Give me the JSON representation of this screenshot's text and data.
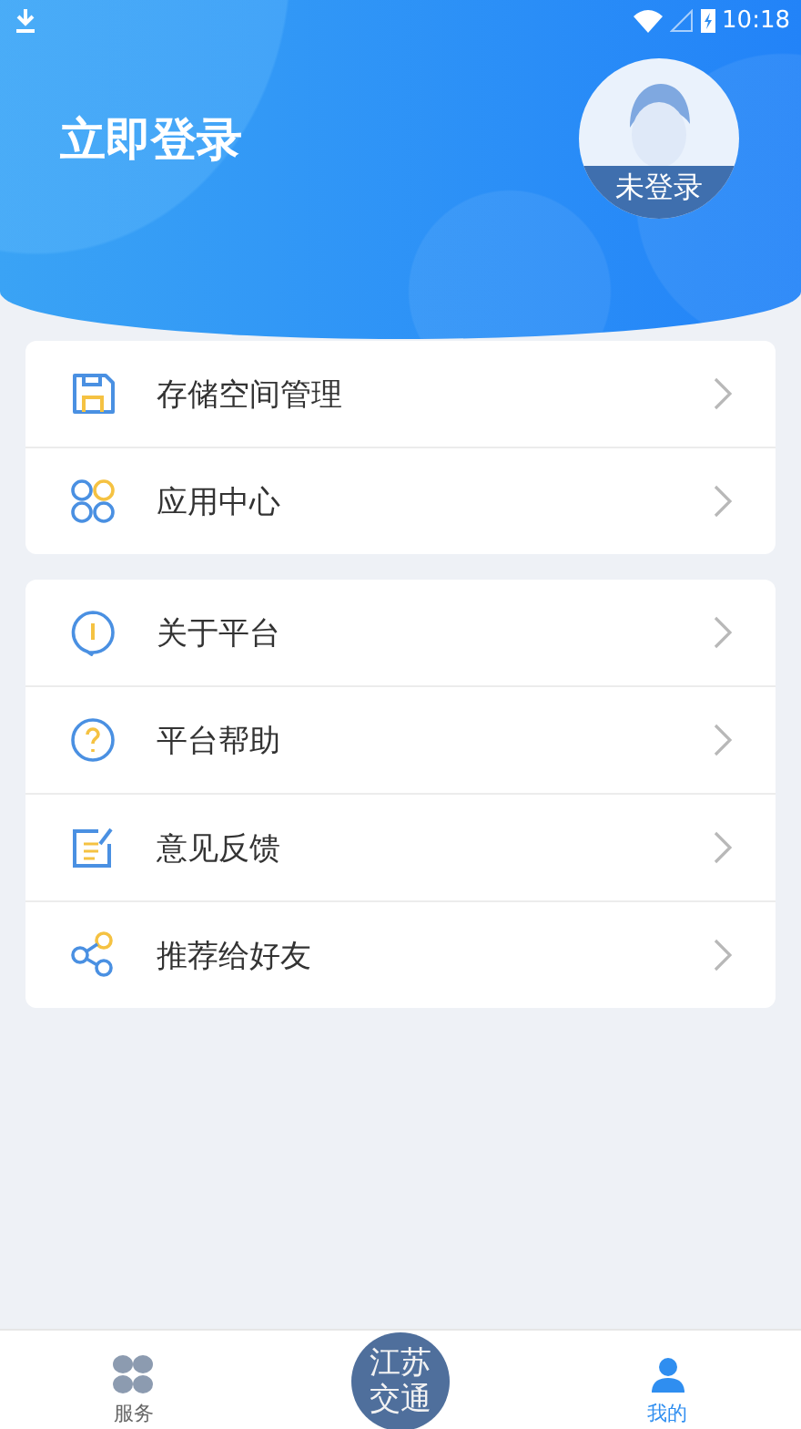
{
  "status_bar": {
    "time": "10:18"
  },
  "header": {
    "title": "立即登录",
    "avatar_label": "未登录"
  },
  "menu_groups": [
    {
      "items": [
        {
          "kind": "storage",
          "label": "存储空间管理"
        },
        {
          "kind": "apps",
          "label": "应用中心"
        }
      ]
    },
    {
      "items": [
        {
          "kind": "info",
          "label": "关于平台"
        },
        {
          "kind": "help",
          "label": "平台帮助"
        },
        {
          "kind": "feedback",
          "label": "意见反馈"
        },
        {
          "kind": "share",
          "label": "推荐给好友"
        }
      ]
    }
  ],
  "bottom_nav": [
    {
      "kind": "grid",
      "label": "服务",
      "selected": false
    },
    {
      "kind": "logo",
      "label": "江苏交通",
      "selected": false
    },
    {
      "kind": "person",
      "label": "我的",
      "selected": true
    }
  ]
}
